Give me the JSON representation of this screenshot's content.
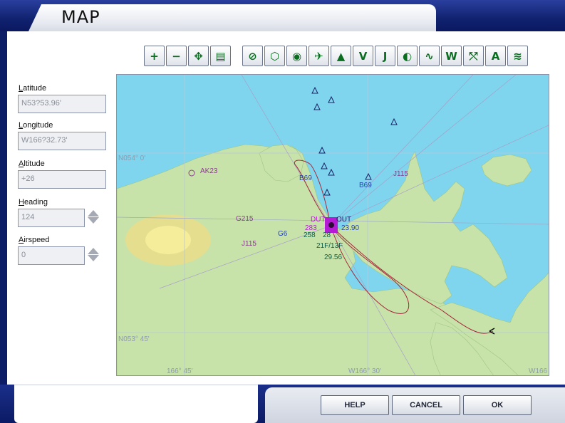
{
  "window": {
    "title": "MAP"
  },
  "toolbar": {
    "groups": [
      [
        {
          "name": "zoom-in-icon",
          "glyph": "+"
        },
        {
          "name": "zoom-out-icon",
          "glyph": "−"
        },
        {
          "name": "center-icon",
          "glyph": "✥"
        },
        {
          "name": "print-icon",
          "glyph": "▤"
        }
      ],
      [
        {
          "name": "airport-icon",
          "glyph": "⊘"
        },
        {
          "name": "ndb-icon",
          "glyph": "⬡"
        },
        {
          "name": "vor-icon",
          "glyph": "◉"
        },
        {
          "name": "flightpath-icon",
          "glyph": "✈"
        },
        {
          "name": "intersection-icon",
          "glyph": "▲"
        },
        {
          "name": "victor-airway-icon",
          "glyph": "V"
        },
        {
          "name": "jet-airway-icon",
          "glyph": "J"
        },
        {
          "name": "airspace-icon",
          "glyph": "◐"
        },
        {
          "name": "route-icon",
          "glyph": "∿"
        },
        {
          "name": "weather-icon",
          "glyph": "W"
        },
        {
          "name": "high-low-icon",
          "glyph": "⤲"
        },
        {
          "name": "altitude-icon",
          "glyph": "A"
        },
        {
          "name": "terrain-icon",
          "glyph": "≋"
        }
      ]
    ]
  },
  "fields": {
    "latitude": {
      "label_u": "L",
      "label_rest": "atitude",
      "value": "N53?53.96'"
    },
    "longitude": {
      "label_u": "L",
      "label_rest": "ongitude",
      "value": "W166?32.73'"
    },
    "altitude": {
      "label_u": "A",
      "label_rest": "ltitude",
      "value": "+26"
    },
    "heading": {
      "label_u": "H",
      "label_rest": "eading",
      "value": "124"
    },
    "airspeed": {
      "label_u": "A",
      "label_rest": "irspeed",
      "value": "0"
    }
  },
  "map": {
    "grid_labels": {
      "n54": "N054° 0'",
      "n53": "N053° 45'",
      "w166": "W166",
      "w166a": "166° 45'",
      "w166b": "W166° 30'"
    },
    "airport_label": "AK23",
    "vor_label": "DUT",
    "intersection_label": "OUT",
    "freq_labels": [
      "283",
      "258",
      "28",
      "23.90"
    ],
    "runway_label": "21F/13F",
    "rwy_len": "29.56",
    "airway_labels": [
      "G215",
      "J115",
      "J115",
      "G6",
      "B69",
      "B69"
    ],
    "colors": {
      "water": "#7fd5ee",
      "land": "#c8e3a9",
      "route": "#a5293a",
      "vor": "#b51ad4",
      "label": "#8a3d8f"
    }
  },
  "buttons": {
    "help": "HELP",
    "cancel": "CANCEL",
    "ok": "OK"
  }
}
